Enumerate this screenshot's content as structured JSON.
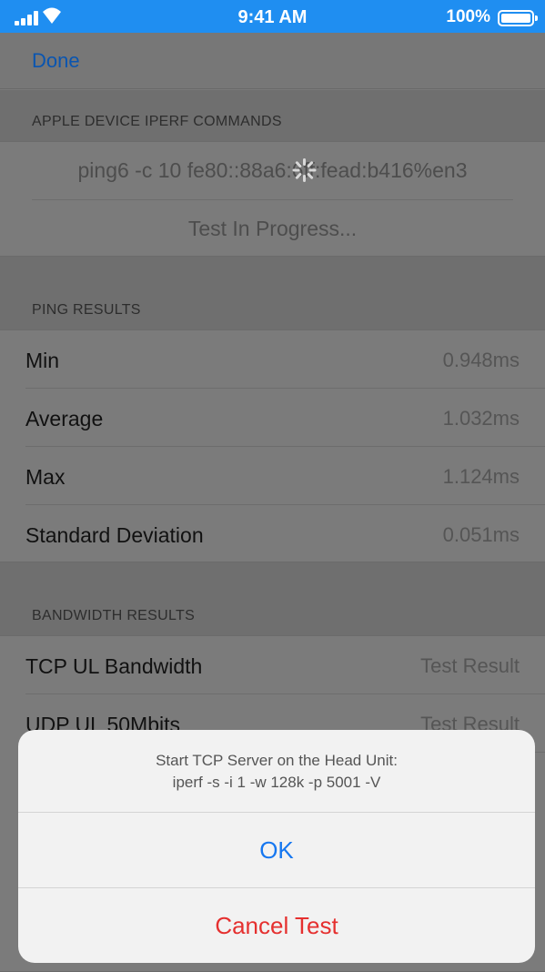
{
  "status_bar": {
    "time": "9:41 AM",
    "battery": "100%"
  },
  "nav": {
    "done": "Done"
  },
  "commands": {
    "header": "APPLE DEVICE IPERF COMMANDS",
    "command": "ping6 -c 10 fe80::88a6:6ff:fead:b416%en3",
    "status": "Test In Progress..."
  },
  "ping": {
    "header": "PING RESULTS",
    "rows": [
      {
        "label": "Min",
        "value": "0.948ms"
      },
      {
        "label": "Average",
        "value": "1.032ms"
      },
      {
        "label": "Max",
        "value": "1.124ms"
      },
      {
        "label": "Standard Deviation",
        "value": "0.051ms"
      }
    ]
  },
  "bandwidth": {
    "header": "BANDWIDTH RESULTS",
    "rows": [
      {
        "label": "TCP UL Bandwidth",
        "value": "Test Result"
      },
      {
        "label": "UDP UL 50Mbits",
        "value": "Test Result"
      }
    ]
  },
  "alert": {
    "message_line1": "Start TCP Server on the Head Unit:",
    "message_line2": "iperf -s -i 1 -w 128k -p 5001 -V",
    "ok": "OK",
    "cancel": "Cancel Test"
  },
  "colors": {
    "status_bar": "#1f8ef1",
    "link": "#1677f0",
    "destructive": "#e5302f"
  }
}
